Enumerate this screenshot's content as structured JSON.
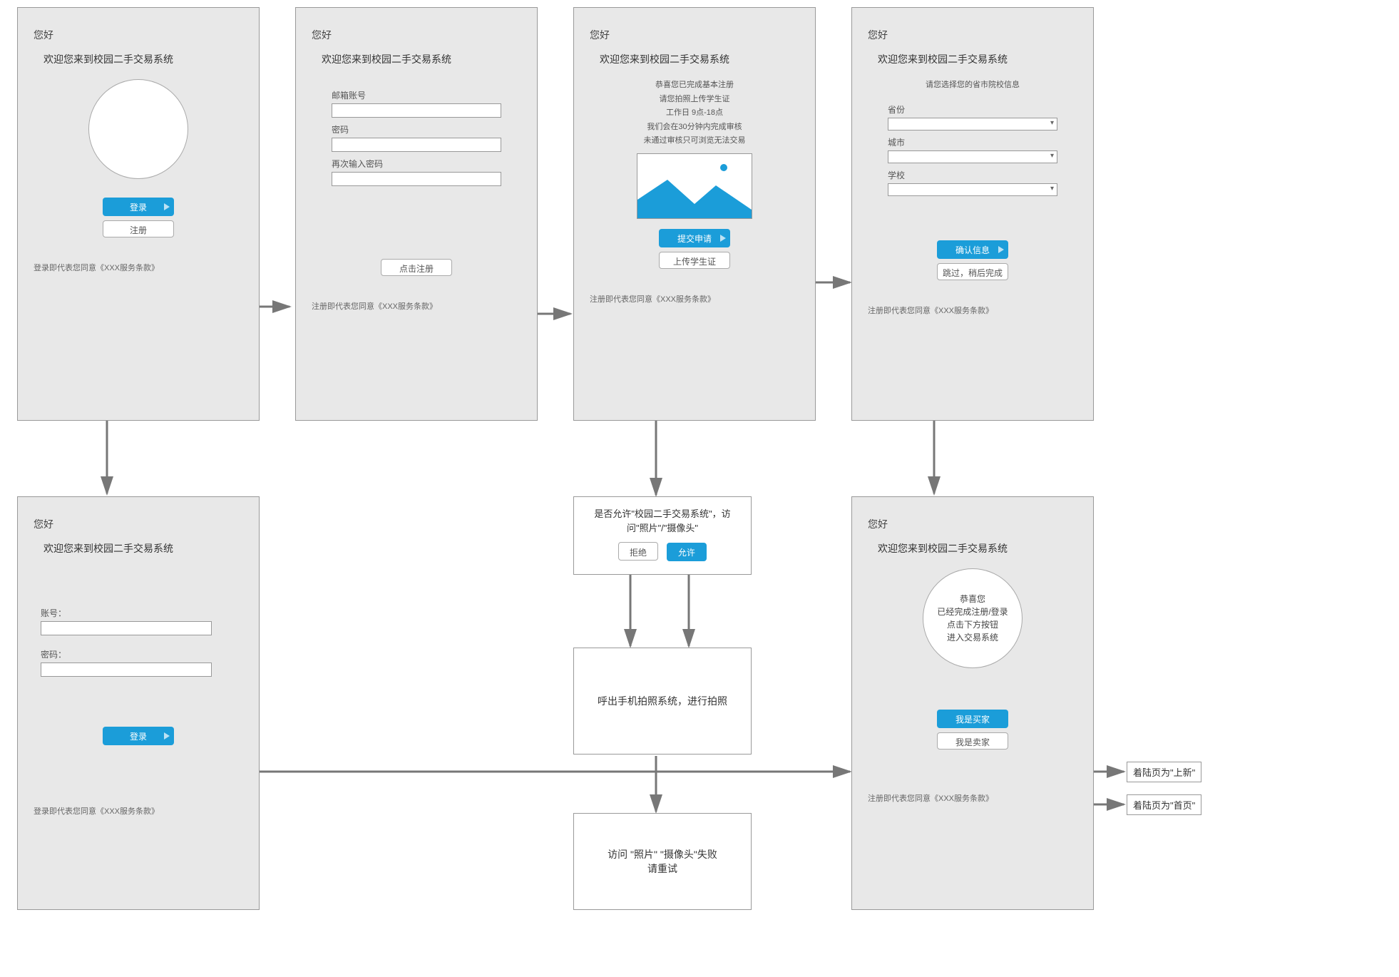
{
  "common": {
    "greet": "您好",
    "welcome": "欢迎您来到校园二手交易系统",
    "login_terms": "登录即代表您同意《XXX服务条款》",
    "register_terms": "注册即代表您同意《XXX服务条款》"
  },
  "s1": {
    "login": "登录",
    "register": "注册"
  },
  "s2": {
    "email": "邮箱账号",
    "password": "密码",
    "password2": "再次输入密码",
    "submit": "点击注册"
  },
  "s3": {
    "l1": "恭喜您已完成基本注册",
    "l2": "请您拍照上传学生证",
    "l3": "工作日 9点-18点",
    "l4": "我们会在30分钟内完成审核",
    "l5": "未通过审核只可浏览无法交易",
    "submit": "提交申请",
    "upload": "上传学生证"
  },
  "s4": {
    "sub": "请您选择您的省市院校信息",
    "province": "省份",
    "city": "城市",
    "school": "学校",
    "confirm": "确认信息",
    "skip": "跳过，稍后完成"
  },
  "s5": {
    "account": "账号：",
    "password": "密码：",
    "login": "登录"
  },
  "perm": {
    "text": "是否允许\"校园二手交易系统\"，访问\"照片\"/\"摄像头\"",
    "deny": "拒绝",
    "allow": "允许"
  },
  "cam": {
    "text": "呼出手机拍照系统，进行拍照"
  },
  "fail": {
    "l1": "访问  \"照片\" \"摄像头\"失败",
    "l2": "请重试"
  },
  "s6": {
    "c1": "恭喜您",
    "c2": "已经完成注册/登录",
    "c3": "点击下方按钮",
    "c4": "进入交易系统",
    "buyer": "我是买家",
    "seller": "我是卖家"
  },
  "notes": {
    "landing_new": "着陆页为\"上新\"",
    "landing_home": "着陆页为\"首页\""
  }
}
